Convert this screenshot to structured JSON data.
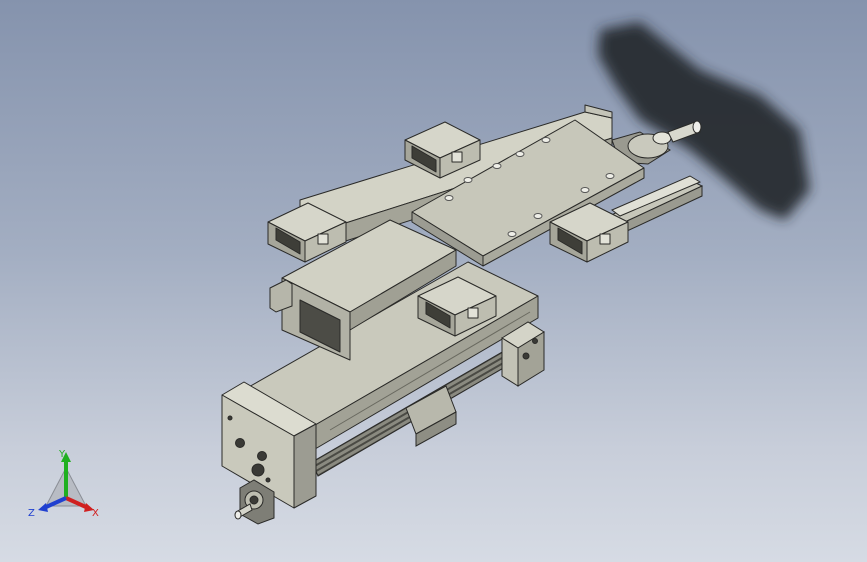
{
  "viewport": {
    "background_top": "#8593ad",
    "background_bottom": "#d6dbe4",
    "part_color": "#bdbdb0",
    "shadow_color": "#23252b"
  },
  "triad": {
    "x_label": "X",
    "y_label": "Y",
    "z_label": "Z",
    "x_color": "#d02020",
    "y_color": "#20b020",
    "z_color": "#2040d0"
  }
}
